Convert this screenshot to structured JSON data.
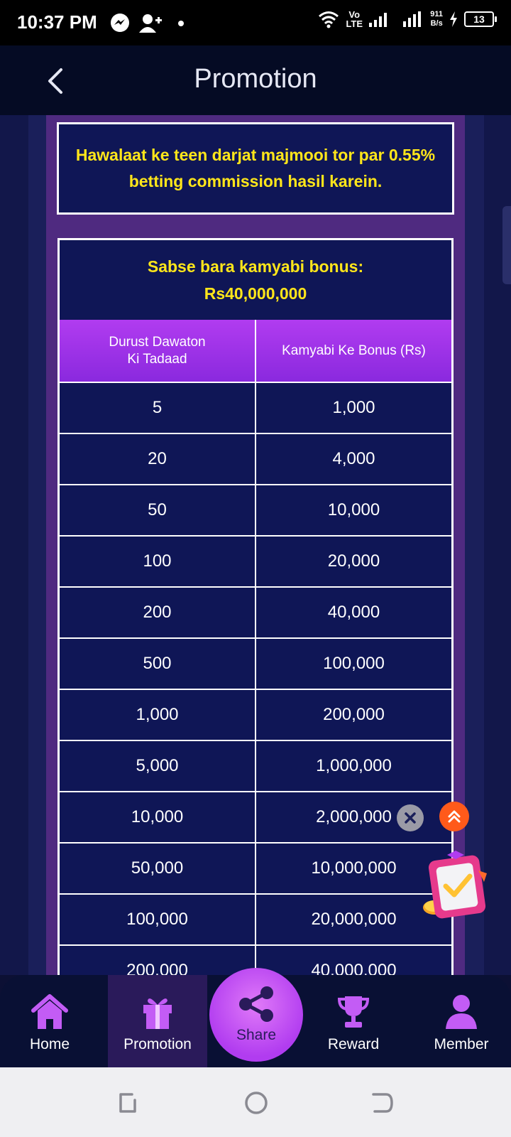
{
  "status_bar": {
    "time": "10:37 PM",
    "network_label": "Vo LTE",
    "speed": "911",
    "speed_unit": "B/s",
    "battery": "13"
  },
  "header": {
    "title": "Promotion"
  },
  "notice": {
    "text": "Hawalaat ke teen darjat majmooi tor par 0.55% betting commission hasil karein."
  },
  "bonus_table": {
    "title_line1": "Sabse bara kamyabi bonus:",
    "title_line2": "Rs40,000,000",
    "col1_header": "Durust Dawaton Ki Tadaad",
    "col2_header": "Kamyabi Ke Bonus (Rs)",
    "rows": [
      {
        "invites": "5",
        "bonus": "1,000"
      },
      {
        "invites": "20",
        "bonus": "4,000"
      },
      {
        "invites": "50",
        "bonus": "10,000"
      },
      {
        "invites": "100",
        "bonus": "20,000"
      },
      {
        "invites": "200",
        "bonus": "40,000"
      },
      {
        "invites": "500",
        "bonus": "100,000"
      },
      {
        "invites": "1,000",
        "bonus": "200,000"
      },
      {
        "invites": "5,000",
        "bonus": "1,000,000"
      },
      {
        "invites": "10,000",
        "bonus": "2,000,000"
      },
      {
        "invites": "50,000",
        "bonus": "10,000,000"
      },
      {
        "invites": "100,000",
        "bonus": "20,000,000"
      },
      {
        "invites": "200,000",
        "bonus": "40,000,000"
      }
    ]
  },
  "bottom_nav": {
    "home": "Home",
    "promotion": "Promotion",
    "share": "Share",
    "reward": "Reward",
    "member": "Member"
  },
  "colors": {
    "accent_purple": "#b13cf0",
    "highlight_yellow": "#ffe61a",
    "table_bg": "#0f1656",
    "panel_purple": "#4f2a80"
  }
}
